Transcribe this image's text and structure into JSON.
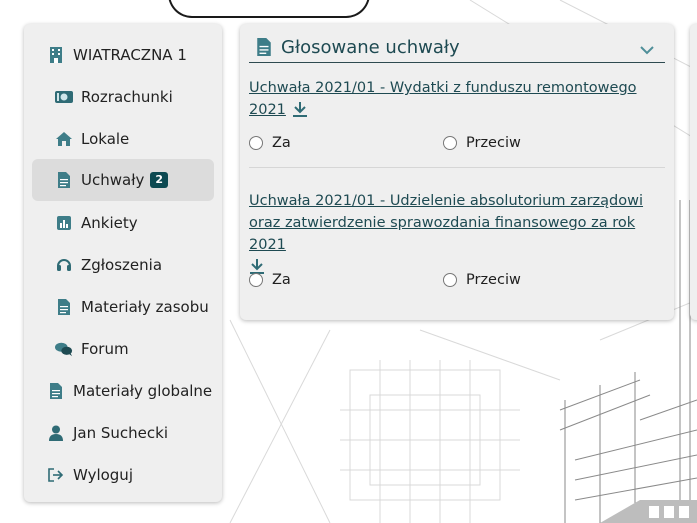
{
  "colors": {
    "accent": "#1e4a52",
    "badge": "#0d4a52",
    "sidebar_bg": "#efefef",
    "active_bg": "#dcdcdc"
  },
  "sidebar": {
    "items": [
      {
        "label": "WIATRACZNA 1",
        "icon": "building-icon"
      },
      {
        "label": "Rozrachunki",
        "icon": "money-icon"
      },
      {
        "label": "Lokale",
        "icon": "home-icon"
      },
      {
        "label": "Uchwały",
        "icon": "document-icon",
        "badge": "2",
        "active": true
      },
      {
        "label": "Ankiety",
        "icon": "chart-icon"
      },
      {
        "label": "Zgłoszenia",
        "icon": "headset-icon"
      },
      {
        "label": "Materiały zasobu",
        "icon": "document-icon"
      },
      {
        "label": "Forum",
        "icon": "chat-icon"
      },
      {
        "label": "Materiały globalne",
        "icon": "document-icon"
      },
      {
        "label": "Jan Suchecki",
        "icon": "user-icon"
      },
      {
        "label": "Wyloguj",
        "icon": "logout-icon"
      }
    ]
  },
  "card": {
    "title": "Głosowane uchwały",
    "resolutions": [
      {
        "title_line1": "Uchwała 2021/01 - Wydatki z funduszu remontowego",
        "title_line2": "2021",
        "option_yes": "Za",
        "option_no": "Przeciw"
      },
      {
        "title_line1": "Uchwała 2021/01 - Udzielenie absolutorium zarządowi",
        "title_line2": "oraz zatwierdzenie sprawozdania finansowego za rok 2021",
        "option_yes": "Za",
        "option_no": "Przeciw"
      }
    ]
  }
}
